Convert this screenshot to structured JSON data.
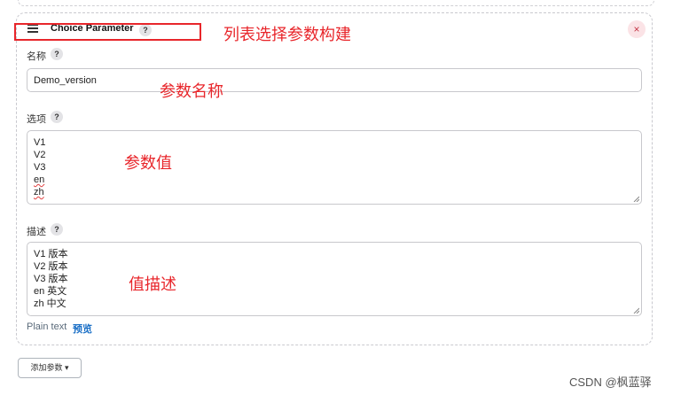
{
  "param_card": {
    "title": "Choice Parameter",
    "help": "?",
    "close": "×"
  },
  "fields": {
    "name": {
      "label": "名称",
      "value": "Demo_version"
    },
    "choices": {
      "label": "选项",
      "lines": [
        "V1",
        "V2",
        "V3",
        "en",
        "zh"
      ]
    },
    "description": {
      "label": "描述",
      "lines": [
        "V1 版本",
        "V2 版本",
        "V3 版本",
        "en 英文",
        "zh 中文"
      ]
    }
  },
  "format": {
    "plain_text": "Plain text",
    "preview": "预览"
  },
  "add_param_button": "添加参数",
  "annotations": {
    "title_note": "列表选择参数构建",
    "name_note": "参数名称",
    "choices_note": "参数值",
    "description_note": "值描述"
  },
  "watermark": "CSDN @枫蓝驿",
  "colors": {
    "annotation_red": "#e8262b",
    "link_blue": "#1a6fc6",
    "close_pink": "#fbe3e6"
  }
}
